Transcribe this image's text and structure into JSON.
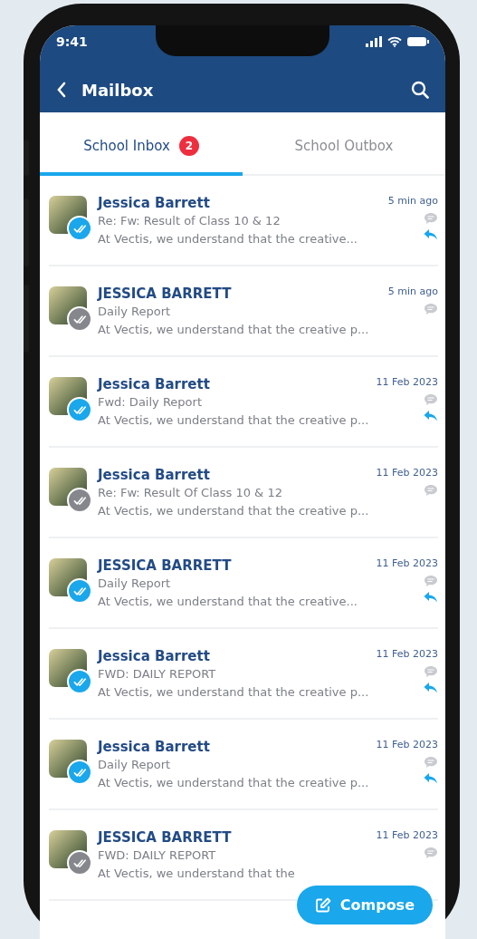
{
  "status_bar": {
    "time": "9:41"
  },
  "app_bar": {
    "title": "Mailbox"
  },
  "tabs": [
    {
      "label": "School Inbox",
      "badge": "2",
      "selected": true
    },
    {
      "label": "School Outbox",
      "selected": false
    }
  ],
  "messages": [
    {
      "sender": "Jessica Barrett",
      "subject": "Re: Fw: Result of Class 10 & 12",
      "preview": "At Vectis, we understand that the creative...",
      "time": "5 min ago",
      "color": "#1aa7ec",
      "replied": true
    },
    {
      "sender": "JESSICA BARRETT",
      "subject": "Daily Report",
      "preview": "At Vectis, we understand that the creative p...",
      "time": "5 min ago",
      "color": "#85878d",
      "replied": false
    },
    {
      "sender": "Jessica Barrett",
      "subject": "Fwd: Daily Report",
      "preview": "At Vectis, we understand that the creative p...",
      "time": "11 Feb 2023",
      "color": "#1aa7ec",
      "replied": true
    },
    {
      "sender": "Jessica Barrett",
      "subject": "Re: Fw: Result Of Class 10 & 12",
      "preview": "At Vectis, we understand that the creative p...",
      "time": "11 Feb 2023",
      "color": "#85878d",
      "replied": false
    },
    {
      "sender": "JESSICA BARRETT",
      "subject": "Daily Report",
      "preview": "At Vectis, we understand that the creative...",
      "time": "11 Feb 2023",
      "color": "#1aa7ec",
      "replied": true
    },
    {
      "sender": "Jessica Barrett",
      "subject": "FWD: DAILY REPORT",
      "preview": "At Vectis, we understand that the creative p...",
      "time": "11 Feb 2023",
      "color": "#1aa7ec",
      "replied": true
    },
    {
      "sender": "Jessica Barrett",
      "subject": "Daily Report",
      "preview": "At Vectis, we understand that the creative p...",
      "time": "11 Feb 2023",
      "color": "#1aa7ec",
      "replied": true
    },
    {
      "sender": "JESSICA BARRETT",
      "subject": "FWD: DAILY REPORT",
      "preview": "At Vectis, we understand that the",
      "time": "11 Feb 2023",
      "color": "#85878d",
      "replied": false
    }
  ],
  "compose_button": {
    "label": "Compose"
  }
}
